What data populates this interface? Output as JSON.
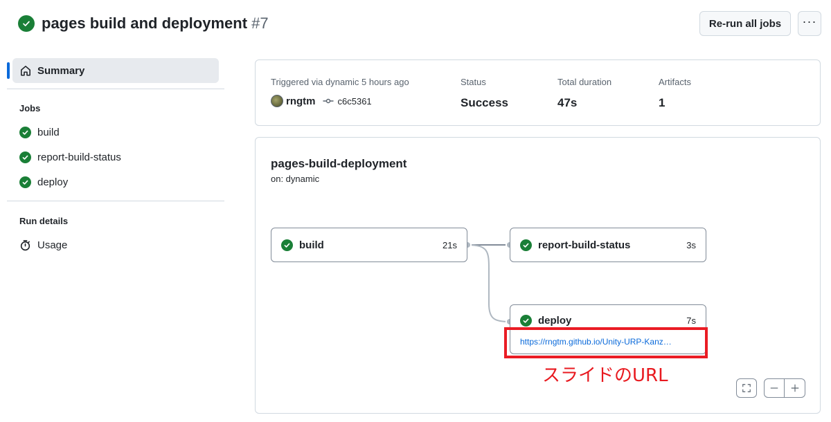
{
  "header": {
    "title": "pages build and deployment",
    "run_number": "#7",
    "rerun_label": "Re-run all jobs",
    "more_label": "···"
  },
  "sidebar": {
    "summary_label": "Summary",
    "jobs_heading": "Jobs",
    "jobs": [
      {
        "label": "build"
      },
      {
        "label": "report-build-status"
      },
      {
        "label": "deploy"
      }
    ],
    "run_details_heading": "Run details",
    "usage_label": "Usage"
  },
  "summary": {
    "triggered_label": "Triggered via dynamic 5 hours ago",
    "user": "rngtm",
    "commit": "c6c5361",
    "status_label": "Status",
    "status_value": "Success",
    "duration_label": "Total duration",
    "duration_value": "47s",
    "artifacts_label": "Artifacts",
    "artifacts_value": "1"
  },
  "workflow": {
    "name": "pages-build-deployment",
    "trigger": "on: dynamic",
    "jobs": {
      "build": {
        "name": "build",
        "duration": "21s"
      },
      "report": {
        "name": "report-build-status",
        "duration": "3s"
      },
      "deploy": {
        "name": "deploy",
        "duration": "7s",
        "url": "https://rngtm.github.io/Unity-URP-Kanz…"
      }
    },
    "annotation": "スライドのURL"
  },
  "colors": {
    "success": "#1a7f37",
    "link": "#0969da",
    "annotation": "#ea1c24"
  }
}
